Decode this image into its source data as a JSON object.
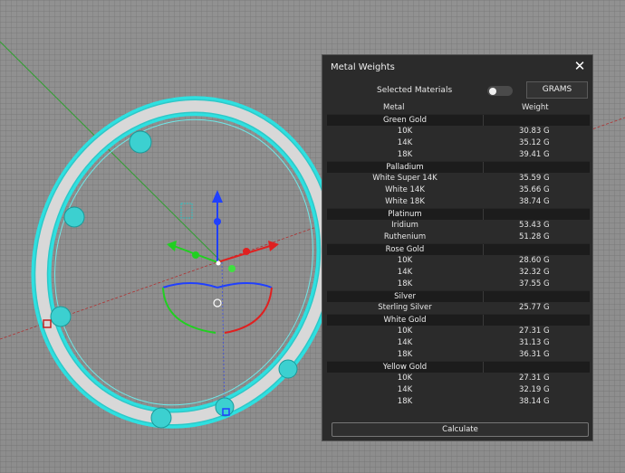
{
  "panel": {
    "title": "Metal Weights",
    "close_icon": "close-icon",
    "selected_materials_label": "Selected Materials",
    "units_button": "GRAMS",
    "calculate_label": "Calculate"
  },
  "table": {
    "col_metal": "Metal",
    "col_weight": "Weight",
    "groups": [
      {
        "name": "Green Gold",
        "rows": [
          {
            "metal": "10K",
            "weight": "30.83 G"
          },
          {
            "metal": "14K",
            "weight": "35.12 G"
          },
          {
            "metal": "18K",
            "weight": "39.41 G"
          }
        ]
      },
      {
        "name": "Palladium",
        "rows": [
          {
            "metal": "White Super 14K",
            "weight": "35.59 G"
          },
          {
            "metal": "White 14K",
            "weight": "35.66 G"
          },
          {
            "metal": "White 18K",
            "weight": "38.74 G"
          }
        ]
      },
      {
        "name": "Platinum",
        "rows": [
          {
            "metal": "Iridium",
            "weight": "53.43 G"
          },
          {
            "metal": "Ruthenium",
            "weight": "51.28 G"
          }
        ]
      },
      {
        "name": "Rose Gold",
        "rows": [
          {
            "metal": "10K",
            "weight": "28.60 G"
          },
          {
            "metal": "14K",
            "weight": "32.32 G"
          },
          {
            "metal": "18K",
            "weight": "37.55 G"
          }
        ]
      },
      {
        "name": "Silver",
        "rows": [
          {
            "metal": "Sterling Silver",
            "weight": "25.77 G"
          }
        ]
      },
      {
        "name": "White Gold",
        "rows": [
          {
            "metal": "10K",
            "weight": "27.31 G"
          },
          {
            "metal": "14K",
            "weight": "31.13 G"
          },
          {
            "metal": "18K",
            "weight": "36.31 G"
          }
        ]
      },
      {
        "name": "Yellow Gold",
        "rows": [
          {
            "metal": "10K",
            "weight": "27.31 G"
          },
          {
            "metal": "14K",
            "weight": "32.19 G"
          },
          {
            "metal": "18K",
            "weight": "38.14 G"
          }
        ]
      }
    ]
  },
  "colors": {
    "ring_highlight": "#2ee0e0",
    "gizmo_x": "#e02020",
    "gizmo_y": "#20d020",
    "gizmo_z": "#2040ff"
  }
}
